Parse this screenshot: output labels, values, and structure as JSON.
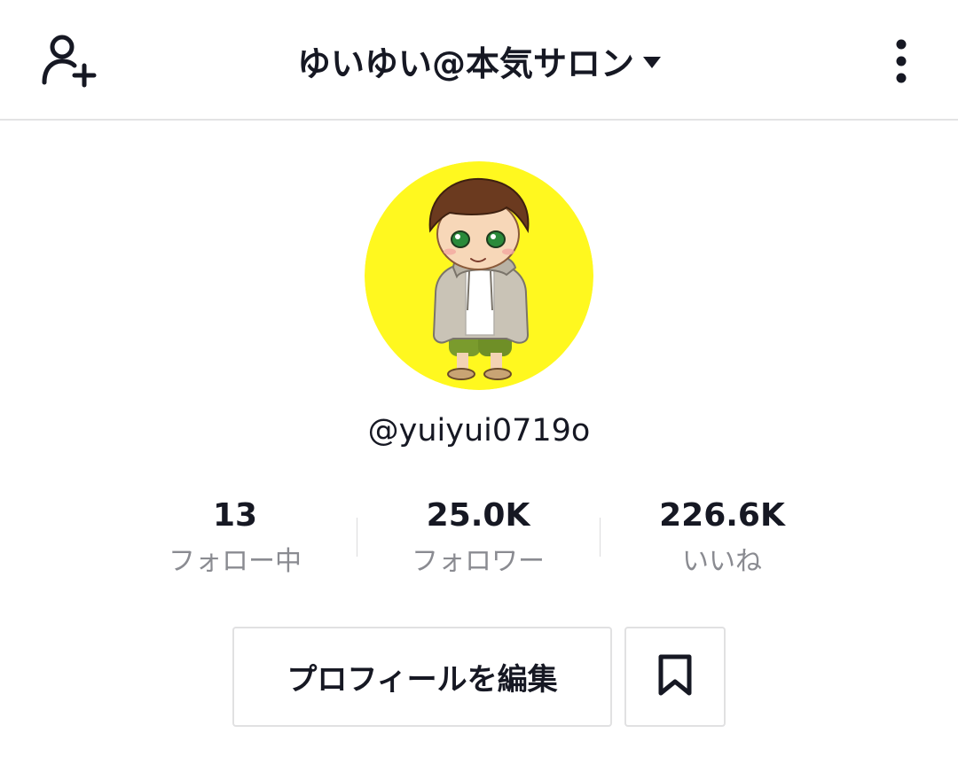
{
  "header": {
    "title": "ゆいゆい@本気サロン",
    "add_user_icon": "add-user-icon",
    "caret_icon": "caret-down-icon",
    "more_icon": "vertical-ellipsis-icon"
  },
  "profile": {
    "avatar_icon": "avatar-illustration",
    "avatar_bg": "#fff81f",
    "username": "@yuiyui0719o"
  },
  "stats": [
    {
      "value": "13",
      "label": "フォロー中"
    },
    {
      "value": "25.0K",
      "label": "フォロワー"
    },
    {
      "value": "226.6K",
      "label": "いいね"
    }
  ],
  "actions": {
    "edit_profile_label": "プロフィールを編集",
    "bookmark_icon": "bookmark-icon"
  }
}
